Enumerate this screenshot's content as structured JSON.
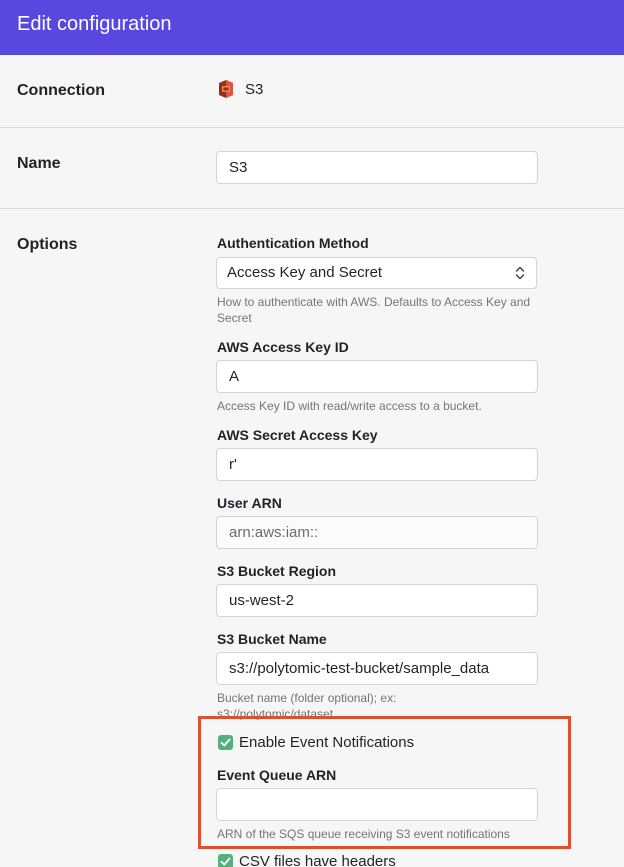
{
  "header": {
    "title": "Edit configuration"
  },
  "connection": {
    "label": "Connection",
    "icon": "s3-icon",
    "value": "S3"
  },
  "name": {
    "label": "Name",
    "value": "S3"
  },
  "options": {
    "label": "Options",
    "auth_method": {
      "label": "Authentication Method",
      "value": "Access Key and Secret",
      "help": "How to authenticate with AWS. Defaults to Access Key and Secret"
    },
    "access_key_id": {
      "label": "AWS Access Key ID",
      "value": "A",
      "help": "Access Key ID with read/write access to a bucket."
    },
    "secret_access_key": {
      "label": "AWS Secret Access Key",
      "value": "r'"
    },
    "user_arn": {
      "label": "User ARN",
      "value": "arn:aws:iam::"
    },
    "bucket_region": {
      "label": "S3 Bucket Region",
      "value": "us-west-2"
    },
    "bucket_name": {
      "label": "S3 Bucket Name",
      "value": "s3://polytomic-test-bucket/sample_data",
      "help": "Bucket name (folder optional); ex: s3://polytomic/dataset"
    },
    "event_notifications": {
      "label": "Enable Event Notifications",
      "checked": true
    },
    "event_queue_arn": {
      "label": "Event Queue ARN",
      "value": "",
      "help": "ARN of the SQS queue receiving S3 event notifications"
    },
    "csv_headers": {
      "label": "CSV files have headers",
      "checked": true
    }
  },
  "colors": {
    "header_bg": "#5848e0",
    "checkbox": "#55b07d",
    "highlight": "#e0502e"
  }
}
